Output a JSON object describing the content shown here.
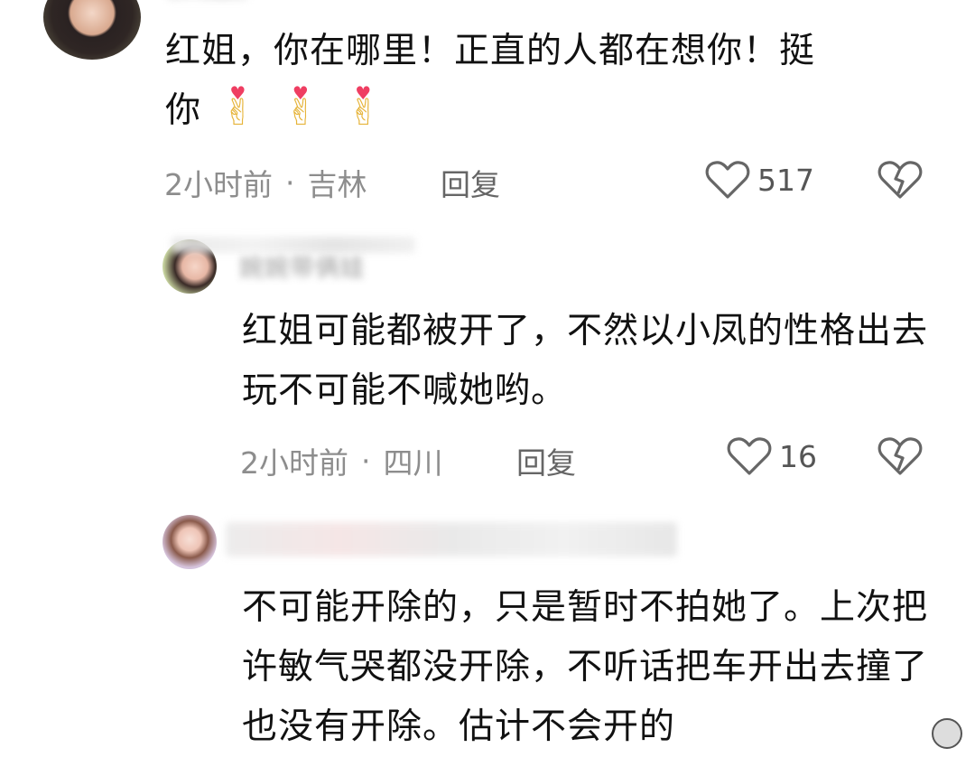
{
  "comments": [
    {
      "text_line1": "红姐，你在哪里！正直的人都在想你！挺",
      "text_line2": "你",
      "emoji": [
        "heart-hands",
        "heart-hands",
        "heart-hands"
      ],
      "time": "2小时前",
      "location": "吉林",
      "reply_label": "回复",
      "likes": "517"
    },
    {
      "username": "婉婉带俩娃",
      "text": "红姐可能都被开了，不然以小凤的性格出去玩不可能不喊她哟。",
      "time": "2小时前",
      "location": "四川",
      "reply_label": "回复",
      "likes": "16"
    },
    {
      "text": "不可能开除的，只是暂时不拍她了。上次把许敏气哭都没开除，不听话把车开出去撞了也没有开除。估计不会开的"
    }
  ],
  "colors": {
    "text": "#111111",
    "meta": "#8d8d8d",
    "icon_stroke": "#666666"
  }
}
